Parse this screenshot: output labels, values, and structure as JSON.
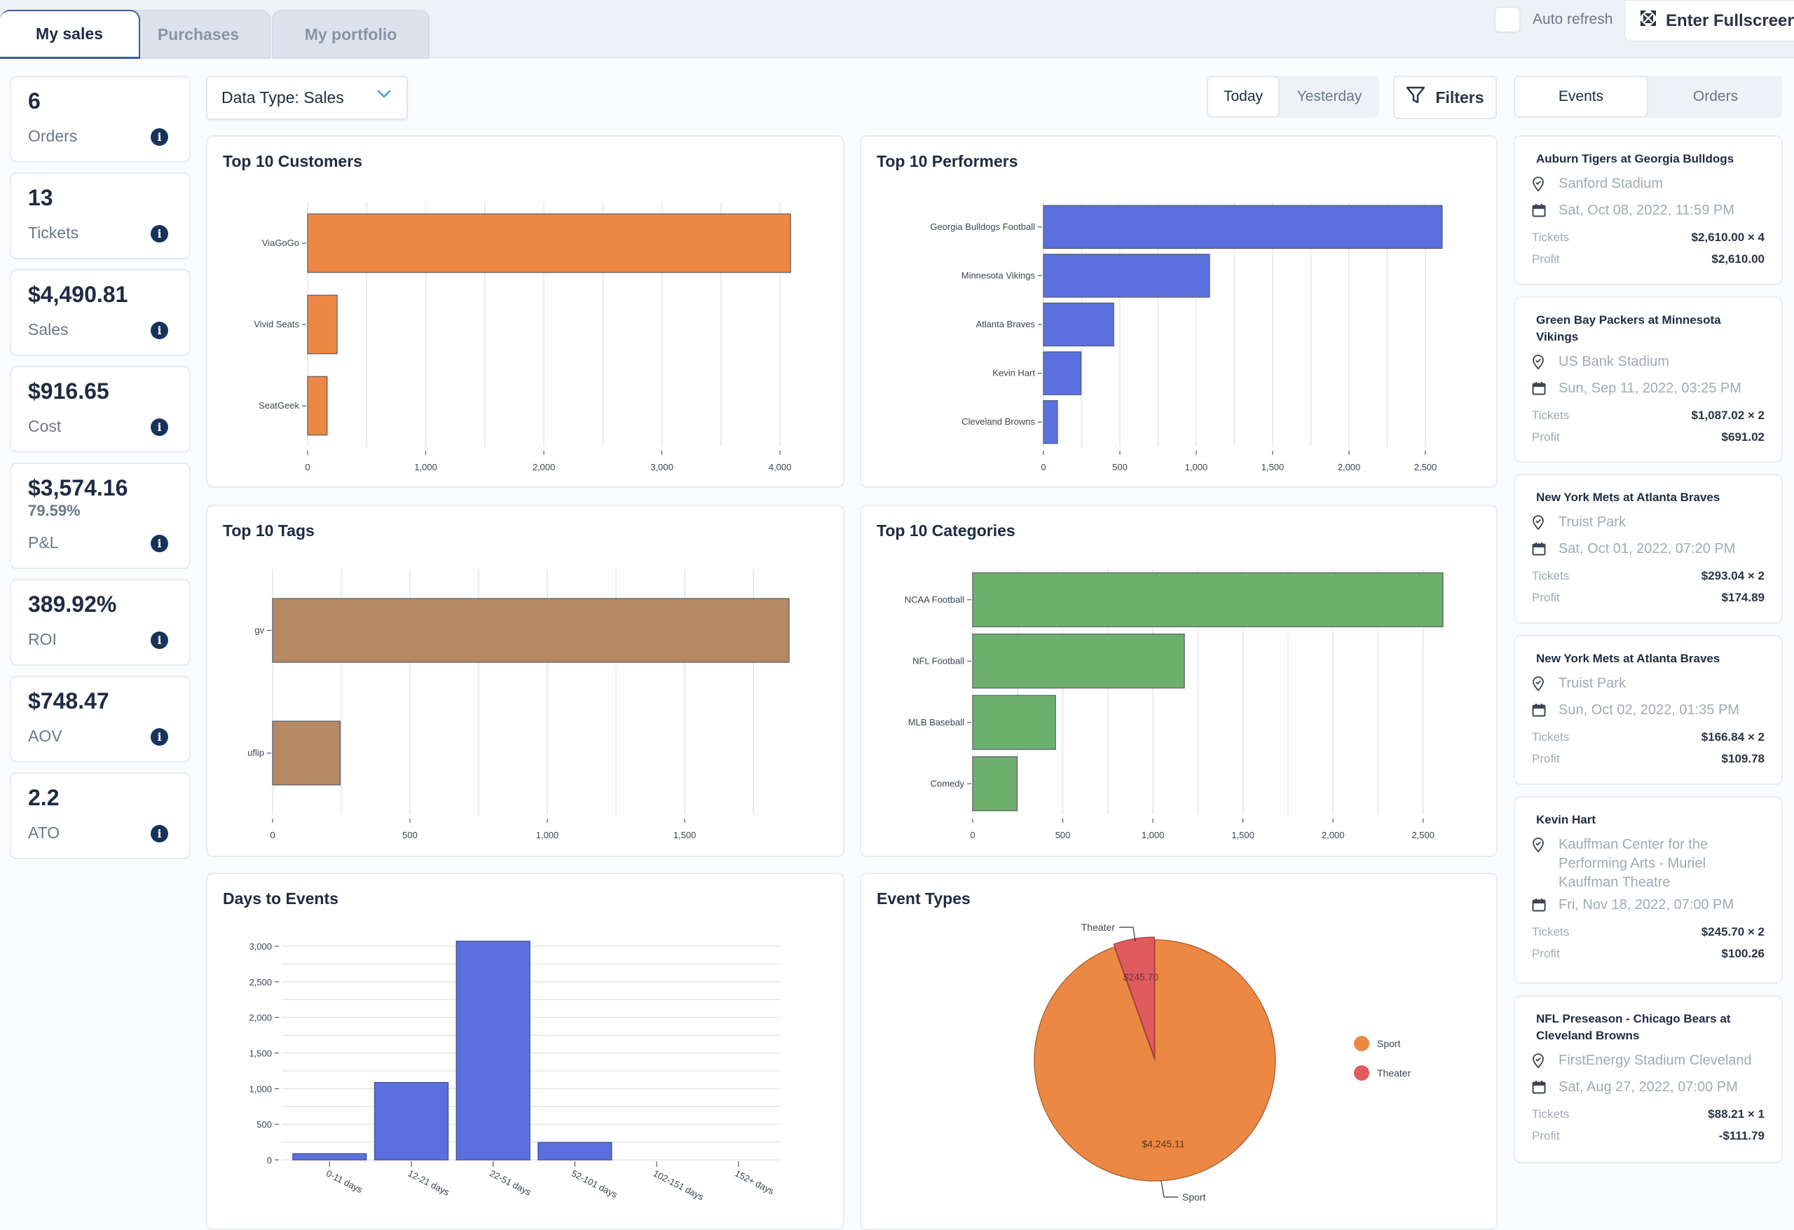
{
  "tabs": [
    {
      "label": "My sales",
      "active": true
    },
    {
      "label": "Purchases",
      "active": false
    },
    {
      "label": "My portfolio",
      "active": false
    }
  ],
  "auto_refresh": {
    "label": "Auto refresh",
    "checked": false
  },
  "fullscreen_label": "Enter Fullscreen",
  "stats": [
    {
      "value": "6",
      "label": "Orders"
    },
    {
      "value": "13",
      "label": "Tickets"
    },
    {
      "value": "$4,490.81",
      "label": "Sales"
    },
    {
      "value": "$916.65",
      "label": "Cost"
    },
    {
      "value": "$3,574.16",
      "sub": "79.59%",
      "label": "P&L"
    },
    {
      "value": "389.92%",
      "label": "ROI"
    },
    {
      "value": "$748.47",
      "label": "AOV"
    },
    {
      "value": "2.2",
      "label": "ATO"
    }
  ],
  "data_type": {
    "label": "Data Type: Sales"
  },
  "date_toggle": {
    "options": [
      "Today",
      "Yesterday"
    ],
    "selected": "Today"
  },
  "filters_label": "Filters",
  "panel_toggle": {
    "options": [
      "Events",
      "Orders"
    ],
    "selected": "Events"
  },
  "colors": {
    "orange": "#ec8843",
    "blue": "#5b70df",
    "brown": "#b58a63",
    "green": "#6db06e",
    "red": "#e05a5e",
    "navy": "#17335b"
  },
  "chart_data": [
    {
      "id": "customers",
      "type": "bar",
      "orientation": "horizontal",
      "title": "Top 10 Customers",
      "categories": [
        "ViaGoGo",
        "Vivid Seats",
        "SeatGeek"
      ],
      "values": [
        4090,
        250,
        165
      ],
      "xlim": [
        0,
        4200
      ],
      "xticks": [
        0,
        1000,
        2000,
        3000,
        4000
      ],
      "xtick_labels": [
        "0",
        "1,000",
        "2,000",
        "3,000",
        "4,000"
      ],
      "grid_step": 500,
      "color": "#ec8843",
      "xlabel": "",
      "ylabel": ""
    },
    {
      "id": "performers",
      "type": "bar",
      "orientation": "horizontal",
      "title": "Top 10 Performers",
      "categories": [
        "Georgia Bulldogs Football",
        "Minnesota Vikings",
        "Atlanta Braves",
        "Kevin Hart",
        "Cleveland Browns"
      ],
      "values": [
        2610,
        1087,
        460,
        246,
        92
      ],
      "xlim": [
        0,
        2610
      ],
      "xticks": [
        0,
        500,
        1000,
        1500,
        2000,
        2500
      ],
      "xtick_labels": [
        "0",
        "500",
        "1,000",
        "1,500",
        "2,000",
        "2,500"
      ],
      "grid_step": 250,
      "color": "#5b70df",
      "xlabel": "",
      "ylabel": ""
    },
    {
      "id": "tags",
      "type": "bar",
      "orientation": "horizontal",
      "title": "Top 10 Tags",
      "categories": [
        "gv",
        "uflip"
      ],
      "values": [
        1880,
        246
      ],
      "xlim": [
        0,
        1880
      ],
      "xticks": [
        0,
        500,
        1000,
        1500
      ],
      "xtick_labels": [
        "0",
        "500",
        "1,000",
        "1,500"
      ],
      "grid_step": 250,
      "color": "#b58a63",
      "xlabel": "",
      "ylabel": ""
    },
    {
      "id": "categories",
      "type": "bar",
      "orientation": "horizontal",
      "title": "Top 10 Categories",
      "categories": [
        "NCAA Football",
        "NFL Football",
        "MLB Baseball",
        "Comedy"
      ],
      "values": [
        2610,
        1175,
        460,
        246
      ],
      "xlim": [
        0,
        2610
      ],
      "xticks": [
        0,
        500,
        1000,
        1500,
        2000,
        2500
      ],
      "xtick_labels": [
        "0",
        "500",
        "1,000",
        "1,500",
        "2,000",
        "2,500"
      ],
      "grid_step": 250,
      "color": "#6db06e",
      "xlabel": "",
      "ylabel": ""
    },
    {
      "id": "days",
      "type": "bar",
      "orientation": "vertical",
      "title": "Days to Events",
      "categories": [
        "0-11 days",
        "12-21 days",
        "22-51 days",
        "52-101 days",
        "102-151 days",
        "152+ days"
      ],
      "values": [
        88,
        1087,
        3070,
        246,
        0,
        0
      ],
      "ylim": [
        0,
        3100
      ],
      "yticks": [
        0,
        500,
        1000,
        1500,
        2000,
        2500,
        3000
      ],
      "ytick_labels": [
        "0",
        "500",
        "1,000",
        "1,500",
        "2,000",
        "2,500",
        "3,000"
      ],
      "grid_step": 250,
      "color": "#5b70df",
      "xlabel": "",
      "ylabel": ""
    },
    {
      "id": "event_types",
      "type": "pie",
      "title": "Event Types",
      "categories": [
        "Sport",
        "Theater"
      ],
      "values": [
        4245.11,
        245.7
      ],
      "value_labels": [
        "$4,245.11",
        "$245.70"
      ],
      "colors": [
        "#ec8843",
        "#e05a5e"
      ],
      "legend": "right"
    }
  ],
  "events": [
    {
      "title": "Auburn Tigers at Georgia Bulldogs",
      "venue": "Sanford Stadium",
      "date": "Sat, Oct 08, 2022, 11:59 PM",
      "tickets_label": "Tickets",
      "tickets": "$2,610.00 × 4",
      "profit_label": "Profit",
      "profit": "$2,610.00"
    },
    {
      "title": "Green Bay Packers at Minnesota Vikings",
      "venue": "US Bank Stadium",
      "date": "Sun, Sep 11, 2022, 03:25 PM",
      "tickets_label": "Tickets",
      "tickets": "$1,087.02 × 2",
      "profit_label": "Profit",
      "profit": "$691.02"
    },
    {
      "title": "New York Mets at Atlanta Braves",
      "venue": "Truist Park",
      "date": "Sat, Oct 01, 2022, 07:20 PM",
      "tickets_label": "Tickets",
      "tickets": "$293.04 × 2",
      "profit_label": "Profit",
      "profit": "$174.89"
    },
    {
      "title": "New York Mets at Atlanta Braves",
      "venue": "Truist Park",
      "date": "Sun, Oct 02, 2022, 01:35 PM",
      "tickets_label": "Tickets",
      "tickets": "$166.84 × 2",
      "profit_label": "Profit",
      "profit": "$109.78"
    },
    {
      "title": "Kevin Hart",
      "venue": "Kauffman Center for the Performing Arts - Muriel Kauffman Theatre",
      "date": "Fri, Nov 18, 2022, 07:00 PM",
      "tickets_label": "Tickets",
      "tickets": "$245.70 × 2",
      "profit_label": "Profit",
      "profit": "$100.26"
    },
    {
      "title": "NFL Preseason - Chicago Bears at Cleveland Browns",
      "venue": "FirstEnergy Stadium Cleveland",
      "date": "Sat, Aug 27, 2022, 07:00 PM",
      "tickets_label": "Tickets",
      "tickets": "$88.21 × 1",
      "profit_label": "Profit",
      "profit": "-$111.79"
    }
  ]
}
